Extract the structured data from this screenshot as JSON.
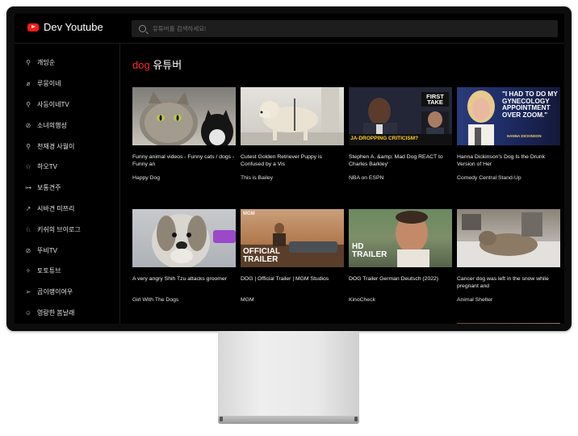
{
  "app": {
    "title": "Dev Youtube",
    "brand_color": "#ff1a1a"
  },
  "search": {
    "placeholder": "유튜버를 검색하세요!"
  },
  "sidebar": {
    "items": [
      {
        "label": "개밍순",
        "icon": "pin-icon"
      },
      {
        "label": "루뭉이네",
        "icon": "leaf-icon"
      },
      {
        "label": "사등이네TV",
        "icon": "pin-icon"
      },
      {
        "label": "소녀의행성",
        "icon": "planet-icon"
      },
      {
        "label": "천재경 사월이",
        "icon": "pin-icon"
      },
      {
        "label": "하오TV",
        "icon": "star-icon"
      },
      {
        "label": "보통견주",
        "icon": "car-icon"
      },
      {
        "label": "시바견 미쯔리",
        "icon": "rocket-icon"
      },
      {
        "label": "키쉬의 브이로그",
        "icon": "cat-icon"
      },
      {
        "label": "뚜비TV",
        "icon": "planet-icon"
      },
      {
        "label": "토토튜브",
        "icon": "sparkle-icon"
      },
      {
        "label": "곰이랭이여우",
        "icon": "send-icon"
      },
      {
        "label": "영랑한 봄날래",
        "icon": "face-icon"
      }
    ]
  },
  "main": {
    "keyword": "dog",
    "title_suffix": "유튜버",
    "videos": [
      {
        "title": "Funny animal videos - Funny cats / dogs - Funny an",
        "channel": "Happy Dog"
      },
      {
        "title": "Cutest Golden Retriever Puppy is Confused by a Vis",
        "channel": "This is Bailey"
      },
      {
        "title": "Stephen A. &amp; Mad Dog REACT to Charles Barkley'",
        "channel": "NBA on ESPN",
        "thumb_text_top": "FIRST TAKE",
        "thumb_text_bottom": "JA-DROPPING CRITICISM?"
      },
      {
        "title": "Hanna Dickinson's Dog Is the Drunk Version of Her",
        "channel": "Comedy Central Stand-Up",
        "thumb_quote": "\"I HAD TO DO MY GYNECOLOGY APPOINTMENT OVER ZOOM.\"",
        "thumb_name": "HANNA DICKINSON"
      },
      {
        "title": "A very angry Shih Tzu attacks groomer",
        "channel": "Girl With The Dogs"
      },
      {
        "title": "DOG | Official Trailer | MGM Studios",
        "channel": "MGM",
        "thumb_brand": "MGM",
        "thumb_caption": "OFFICIAL TRAILER"
      },
      {
        "title": "DOG Trailer German Deutsch (2022)",
        "channel": "KinoCheck",
        "thumb_caption": "HD TRAILER"
      },
      {
        "title": "Cancer dog was left in the snow while pregnant and",
        "channel": "Animal Shelter"
      }
    ]
  }
}
